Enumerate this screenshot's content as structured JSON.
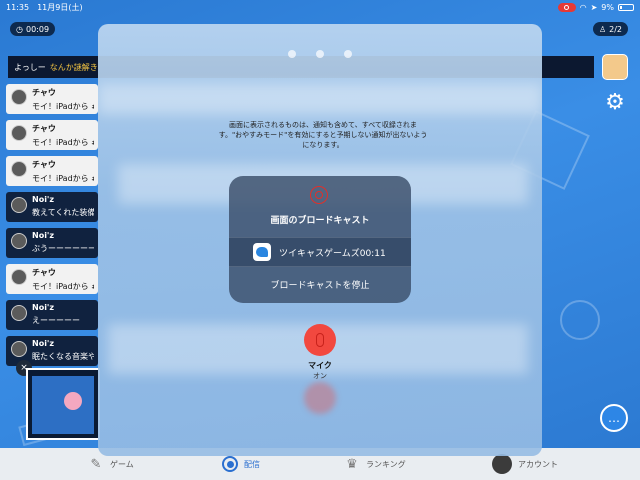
{
  "status_bar": {
    "time": "11:35",
    "date": "11月9日(土)",
    "battery": "9%"
  },
  "background": {
    "timer": "00:09",
    "viewers": "2/2",
    "ticker": {
      "user": "よっしー",
      "message": "なんか謎解き"
    },
    "comments": [
      {
        "name": "チャウ",
        "text": "モイ！iPadから #",
        "style": "light"
      },
      {
        "name": "チャウ",
        "text": "モイ！iPadから #",
        "style": "light"
      },
      {
        "name": "チャウ",
        "text": "モイ！iPadから #",
        "style": "light"
      },
      {
        "name": "Noi'z",
        "text": "教えてくれた装備",
        "style": "dark"
      },
      {
        "name": "Noi'z",
        "text": "ぶうーーーーーーー",
        "style": "dark"
      },
      {
        "name": "チャウ",
        "text": "モイ！iPadから #",
        "style": "light"
      },
      {
        "name": "Noi'z",
        "text": "えーーーーー",
        "style": "dark"
      },
      {
        "name": "Noi'z",
        "text": "眠たくなる音楽や",
        "style": "dark"
      }
    ],
    "close_glyph": "×"
  },
  "tabbar": {
    "items": [
      {
        "label": "ゲーム",
        "icon": "game-controller-icon"
      },
      {
        "label": "配信",
        "icon": "broadcast-icon",
        "active": true
      },
      {
        "label": "ランキング",
        "icon": "crown-icon"
      },
      {
        "label": "アカウント",
        "icon": "avatar-icon"
      }
    ]
  },
  "overlay": {
    "info": "画面に表示されるものは、通知も含めて、すべて収録されます。\"おやすみモード\"を有効にすると予期しない通知が出ないようになります。",
    "card": {
      "title": "画面のブロードキャスト",
      "app_name": "ツイキャスゲームズ",
      "app_time": "00:11",
      "stop_label": "ブロードキャストを停止"
    },
    "mic": {
      "label": "マイク",
      "state": "オン"
    }
  },
  "colors": {
    "accent": "#2a6fd0",
    "record_red": "#e0302a",
    "mic_red": "#f2483f"
  }
}
